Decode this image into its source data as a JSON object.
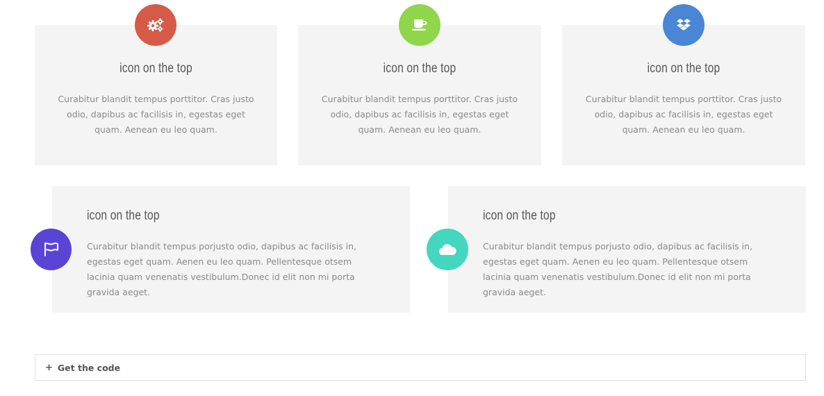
{
  "top_cards": [
    {
      "icon": "gears-icon",
      "color": "#d65a48",
      "title": "icon on the top",
      "text": "Curabitur blandit tempus porttitor. Cras justo odio, dapibus ac facilisis in, egestas eget quam. Aenean eu leo quam."
    },
    {
      "icon": "coffee-cup-icon",
      "color": "#8fd64a",
      "title": "icon on the top",
      "text": "Curabitur blandit tempus porttitor. Cras justo odio, dapibus ac facilisis in, egestas eget quam. Aenean eu leo quam."
    },
    {
      "icon": "dropbox-icon",
      "color": "#4a86d6",
      "title": "icon on the top",
      "text": "Curabitur blandit tempus porttitor. Cras justo odio, dapibus ac facilisis in, egestas eget quam. Aenean eu leo quam."
    }
  ],
  "side_cards": [
    {
      "icon": "flag-icon",
      "color": "#5a44d6",
      "title": "icon on the top",
      "text": "Curabitur blandit tempus porjusto odio, dapibus ac facilisis in, egestas eget quam. Aenen eu leo quam. Pellentesque otsem lacinia quam venenatis vestibulum.Donec id elit non mi porta gravida aeget."
    },
    {
      "icon": "cloud-icon",
      "color": "#44d6bf",
      "title": "icon on the top",
      "text": "Curabitur blandit tempus porjusto odio, dapibus ac facilisis in, egestas eget quam. Aenen eu leo quam. Pellentesque otsem lacinia quam venenatis vestibulum.Donec id elit non mi porta gravida aeget."
    }
  ],
  "code_toggle": {
    "icon": "plus",
    "label": "Get the code"
  }
}
